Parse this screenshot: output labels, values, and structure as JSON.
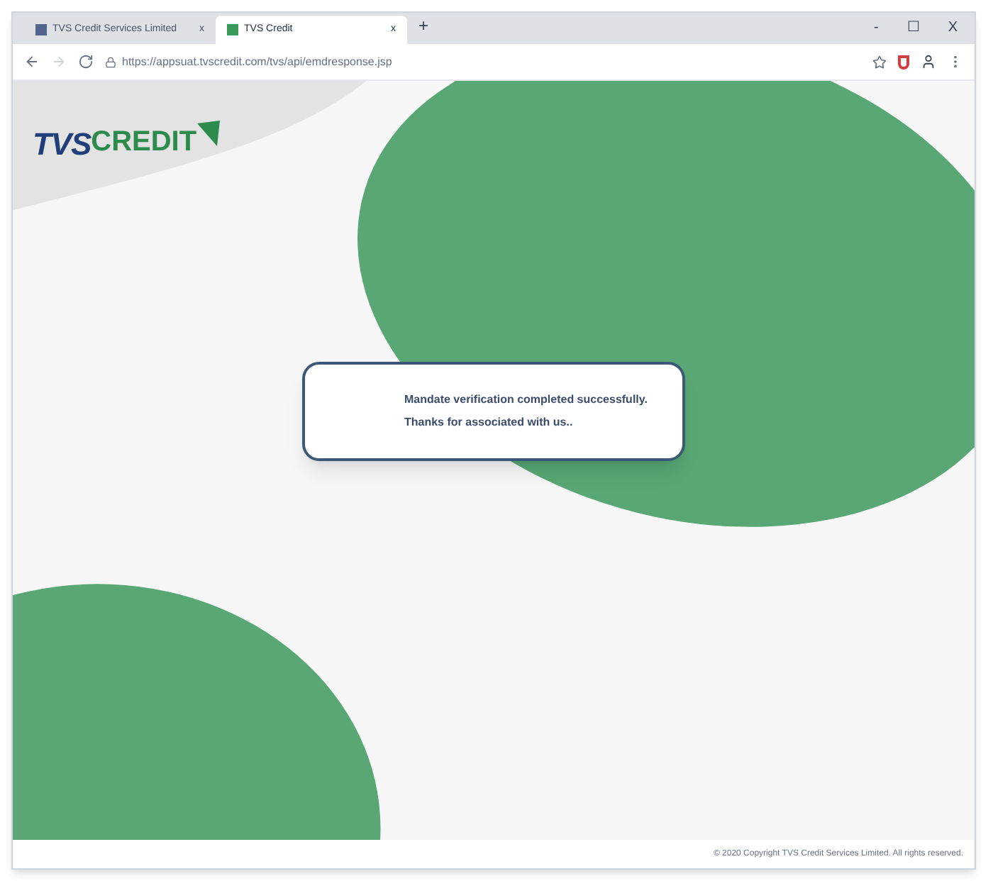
{
  "tabs": [
    {
      "title": "TVS Credit Services Limited",
      "close": "x",
      "selected": false
    },
    {
      "title": "TVS Credit",
      "close": "x",
      "selected": true
    }
  ],
  "new_tab": "+",
  "window_controls": {
    "minimize": "-",
    "maximize": "☐",
    "close": "X"
  },
  "address_bar": {
    "url": "https://appsuat.tvscredit.com/tvs/api/emdresponse.jsp"
  },
  "logo": {
    "part_1": "TVS",
    "part_2": "CREDIT"
  },
  "message": {
    "lines": [
      "Mandate verification completed successfully.",
      "Thanks for associated with us.."
    ]
  },
  "footer": {
    "copyright": "© 2020 Copyright TVS Credit Services Limited. All rights reserved."
  }
}
